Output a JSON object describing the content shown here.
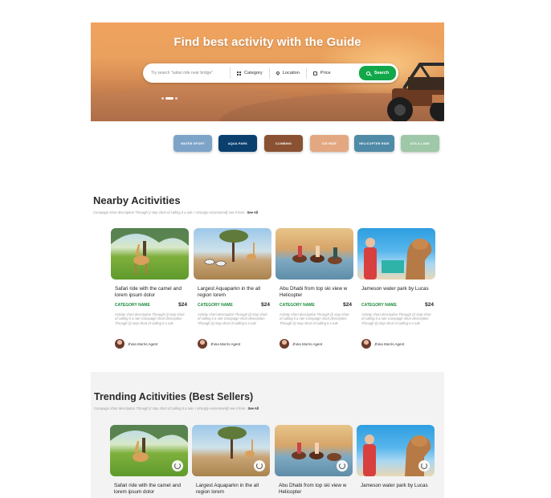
{
  "hero": {
    "title": "Find best activity with the Guide",
    "search_placeholder": "Try search \"safari ride near bridge\"",
    "filters": {
      "category": "Category",
      "location": "Location",
      "price": "Price"
    },
    "search_button": "Search",
    "slides": 3,
    "active_slide": 2
  },
  "categories": [
    {
      "label": "Water sport",
      "color": "#7da4c8"
    },
    {
      "label": "Aqua park",
      "color": "#0b3f6e"
    },
    {
      "label": "Climbing",
      "color": "#8a5232"
    },
    {
      "label": "Ice ride",
      "color": "#e3a882"
    },
    {
      "label": "Helicopter ride",
      "color": "#4f8aa6"
    },
    {
      "label": "Atila lane",
      "color": "#9ec8a8"
    }
  ],
  "nearby": {
    "title": "Nearby Acitivities",
    "subtitle": "Compaign short description Through (I stop short of calling it a rule. I strongly recommend) see it from.",
    "see_all": "See All",
    "cards": [
      {
        "title": "Safari ride with the camel and lorem ipsum dolor",
        "category": "CATEGORY NAME",
        "price": "$24",
        "desc": "Activity short description Through (I) stop short of calling it a rule Compaign short description Through (I) stop short of calling it a rule",
        "agent": "Jhina Morris Agent"
      },
      {
        "title": "Largest Aquaparkn in the all region lorem",
        "category": "CATEGORY NAME",
        "price": "$24",
        "desc": "Activity short description Through (I) stop short of calling it a rule Compaign short description Through (I) stop short of calling it a rule",
        "agent": "Jhina Morris Agent"
      },
      {
        "title": "Abu Dhabi from top ski view w Helicopter",
        "category": "CATEGORY NAME",
        "price": "$24",
        "desc": "Activity short description Through (I) stop short of calling it a rule Compaign short description Through (I) stop short of calling it a rule",
        "agent": "Jhina Morris Agent"
      },
      {
        "title": "Jameson water park by Lucas",
        "category": "CATEGORY NAME",
        "price": "$24",
        "desc": "Activity short description Through (I) stop short of calling it a rule Compaign short description Through (I) stop short of calling it a rule",
        "agent": "Jhina Morris Agent"
      }
    ]
  },
  "trending": {
    "title": "Trending Acitivities (Best Sellers)",
    "subtitle": "Compaign short description Through (I stop short of calling it a rule. I strongly recommend) see it from.",
    "see_all": "See All",
    "cards": [
      {
        "title": "Safari ride with the camel and lorem ipsum dolor"
      },
      {
        "title": "Largest Aquaparkn in the all region lorem"
      },
      {
        "title": "Abu Dhabi from top ski view w Helicopter"
      },
      {
        "title": "Jameson water park by Lucas"
      }
    ]
  },
  "icons": [
    "category-grid-icon",
    "location-pin-icon",
    "price-tag-icon",
    "search-icon",
    "heart-icon"
  ],
  "colors": {
    "accent_green": "#12a84a",
    "category_green": "#1b8c3a"
  }
}
